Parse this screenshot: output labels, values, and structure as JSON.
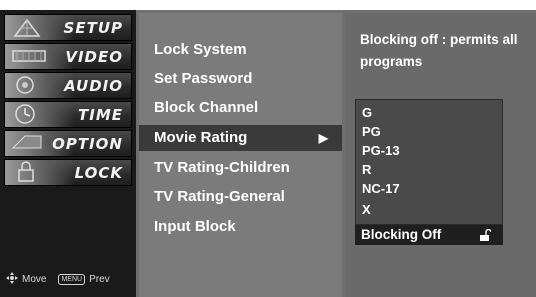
{
  "sidebar": {
    "categories": [
      {
        "label": "SETUP",
        "icon": "satellite-dish-icon"
      },
      {
        "label": "VIDEO",
        "icon": "film-reel-icon"
      },
      {
        "label": "AUDIO",
        "icon": "speaker-icon"
      },
      {
        "label": "TIME",
        "icon": "clock-icon"
      },
      {
        "label": "OPTION",
        "icon": "option-tag-icon"
      },
      {
        "label": "LOCK",
        "icon": "padlock-icon"
      }
    ],
    "footer": {
      "move_label": "Move",
      "menu_key": "MENU",
      "prev_label": "Prev"
    }
  },
  "menu": {
    "items": [
      {
        "label": "Lock System"
      },
      {
        "label": "Set Password"
      },
      {
        "label": "Block Channel"
      },
      {
        "label": "Movie Rating",
        "selected": true,
        "arrow": "▶"
      },
      {
        "label": "TV Rating-Children"
      },
      {
        "label": "TV Rating-General"
      },
      {
        "label": "Input Block"
      }
    ]
  },
  "detail": {
    "description_line1": "Blocking off : permits all",
    "description_line2": "programs",
    "ratings": [
      "G",
      "PG",
      "PG-13",
      "R",
      "NC-17",
      "X"
    ],
    "blocking_option": "Blocking Off"
  },
  "colors": {
    "background": "#6f6f6f",
    "sidebar": "#1a1a1a",
    "selected": "#3a3a3a",
    "text": "#ffffff"
  }
}
